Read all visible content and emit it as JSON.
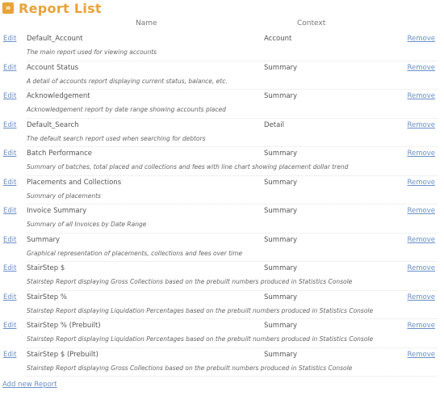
{
  "page": {
    "title": "Report List",
    "title_icon": "double-chevron-right-icon",
    "accent_color": "#e8a23a",
    "link_color": "#6a8fc7"
  },
  "table": {
    "headers": {
      "name": "Name",
      "context": "Context"
    },
    "edit_label": "Edit",
    "remove_label": "Remove",
    "rows": [
      {
        "name": "Default_Account",
        "context": "Account",
        "description": "The main report used for viewing accounts"
      },
      {
        "name": "Account Status",
        "context": "Summary",
        "description": "A detail of accounts report displaying current status, balance, etc."
      },
      {
        "name": "Acknowledgement",
        "context": "Summary",
        "description": "Acknowledgement report by date range showing accounts placed"
      },
      {
        "name": "Default_Search",
        "context": "Detail",
        "description": "The default search report used when searching for debtors"
      },
      {
        "name": "Batch Performance",
        "context": "Summary",
        "description": "Summary of batches, total placed and collections and fees with line chart showing placement dollar trend"
      },
      {
        "name": "Placements and Collections",
        "context": "Summary",
        "description": "Summary of placements"
      },
      {
        "name": "Invoice Summary",
        "context": "Summary",
        "description": "Summary of all Invoices by Date Range"
      },
      {
        "name": "Summary",
        "context": "Summary",
        "description": "Graphical representation of placements, collections and fees over time"
      },
      {
        "name": "StairStep $",
        "context": "Summary",
        "description": "Stairstep Report displaying Gross Collections based on the prebuilt numbers produced in Statistics Console"
      },
      {
        "name": "StairStep %",
        "context": "Summary",
        "description": "Stairstep Report displaying Liquidation Percentages based on the prebuilt numbers produced in Statistics Console"
      },
      {
        "name": "StairStep % (Prebuilt)",
        "context": "Summary",
        "description": "Stairstep Report displaying Liquidation Percentages based on the prebuilt numbers produced in Statistics Console"
      },
      {
        "name": "StairStep $ (Prebuilt)",
        "context": "Summary",
        "description": "Stairstep Report displaying Gross Collections based on the prebuilt numbers produced in Statistics Console"
      }
    ]
  },
  "footer": {
    "add_label": "Add new Report"
  }
}
